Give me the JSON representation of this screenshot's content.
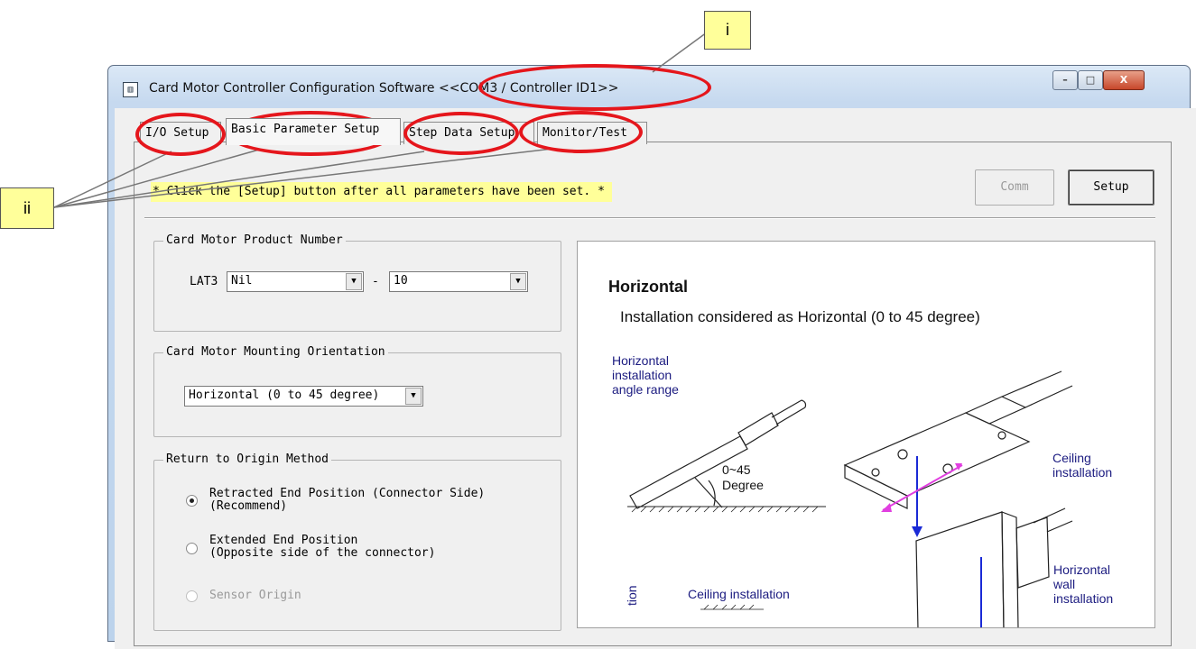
{
  "window": {
    "title": "Card Motor Controller Configuration Software <<COM3 / Controller ID1>>",
    "icon": "app-icon",
    "controls": {
      "minimize": "–",
      "maximize": "□",
      "close": "X"
    }
  },
  "tabs": [
    {
      "label": "I/O Setup"
    },
    {
      "label": "Basic Parameter Setup"
    },
    {
      "label": "Step Data Setup"
    },
    {
      "label": "Monitor/Test"
    }
  ],
  "hint": "* Click the [Setup] button after all parameters have been set. *",
  "buttons": {
    "comm": "Comm",
    "setup": "Setup"
  },
  "product_number": {
    "legend": "Card Motor Product Number",
    "prefix": "LAT3",
    "combo1": "Nil",
    "separator": "-",
    "combo2": "10"
  },
  "orientation": {
    "legend": "Card Motor Mounting Orientation",
    "value": "Horizontal (0 to 45 degree)"
  },
  "origin": {
    "legend": "Return to Origin Method",
    "options": [
      {
        "line1": "Retracted End Position (Connector Side)",
        "line2": "(Recommend)",
        "selected": true
      },
      {
        "line1": "Extended End Position",
        "line2": "(Opposite side of the connector)",
        "selected": false
      },
      {
        "line1": "Sensor Origin",
        "line2": "",
        "selected": false,
        "disabled": true
      }
    ]
  },
  "diagram": {
    "title": "Horizontal",
    "subtitle": "Installation considered as Horizontal (0 to 45 degree)",
    "angle_label": [
      "Horizontal",
      "installation",
      "angle range"
    ],
    "angle_value": [
      "0~45",
      "Degree"
    ],
    "ceiling": [
      "Ceiling",
      "installation"
    ],
    "wall": [
      "Horizontal",
      "wall",
      "installation"
    ],
    "ceiling_bottom": "Ceiling installation",
    "rotated_partial": "tion"
  },
  "annotations": {
    "i": "i",
    "ii": "ii"
  },
  "colors": {
    "highlight": "#ffff99",
    "annotation_red": "#e5161c",
    "navy_text": "#1b1b80"
  }
}
